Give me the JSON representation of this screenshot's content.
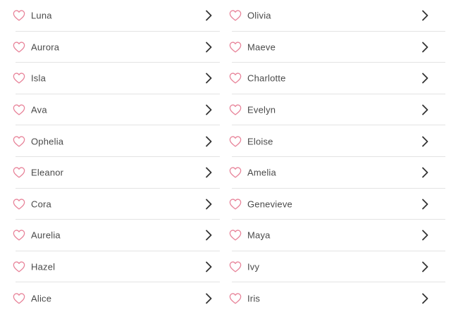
{
  "colors": {
    "heart": "#e8849a",
    "chevron": "#333333",
    "divider": "#e3e3e3",
    "text": "#4a4a4a"
  },
  "icons": {
    "favorite": "heart-outline-icon",
    "open": "chevron-right-icon"
  },
  "left_names": [
    "Luna",
    "Aurora",
    "Isla",
    "Ava",
    "Ophelia",
    "Eleanor",
    "Cora",
    "Aurelia",
    "Hazel",
    "Alice"
  ],
  "right_names": [
    "Olivia",
    "Maeve",
    "Charlotte",
    "Evelyn",
    "Eloise",
    "Amelia",
    "Genevieve",
    "Maya",
    "Ivy",
    "Iris"
  ]
}
